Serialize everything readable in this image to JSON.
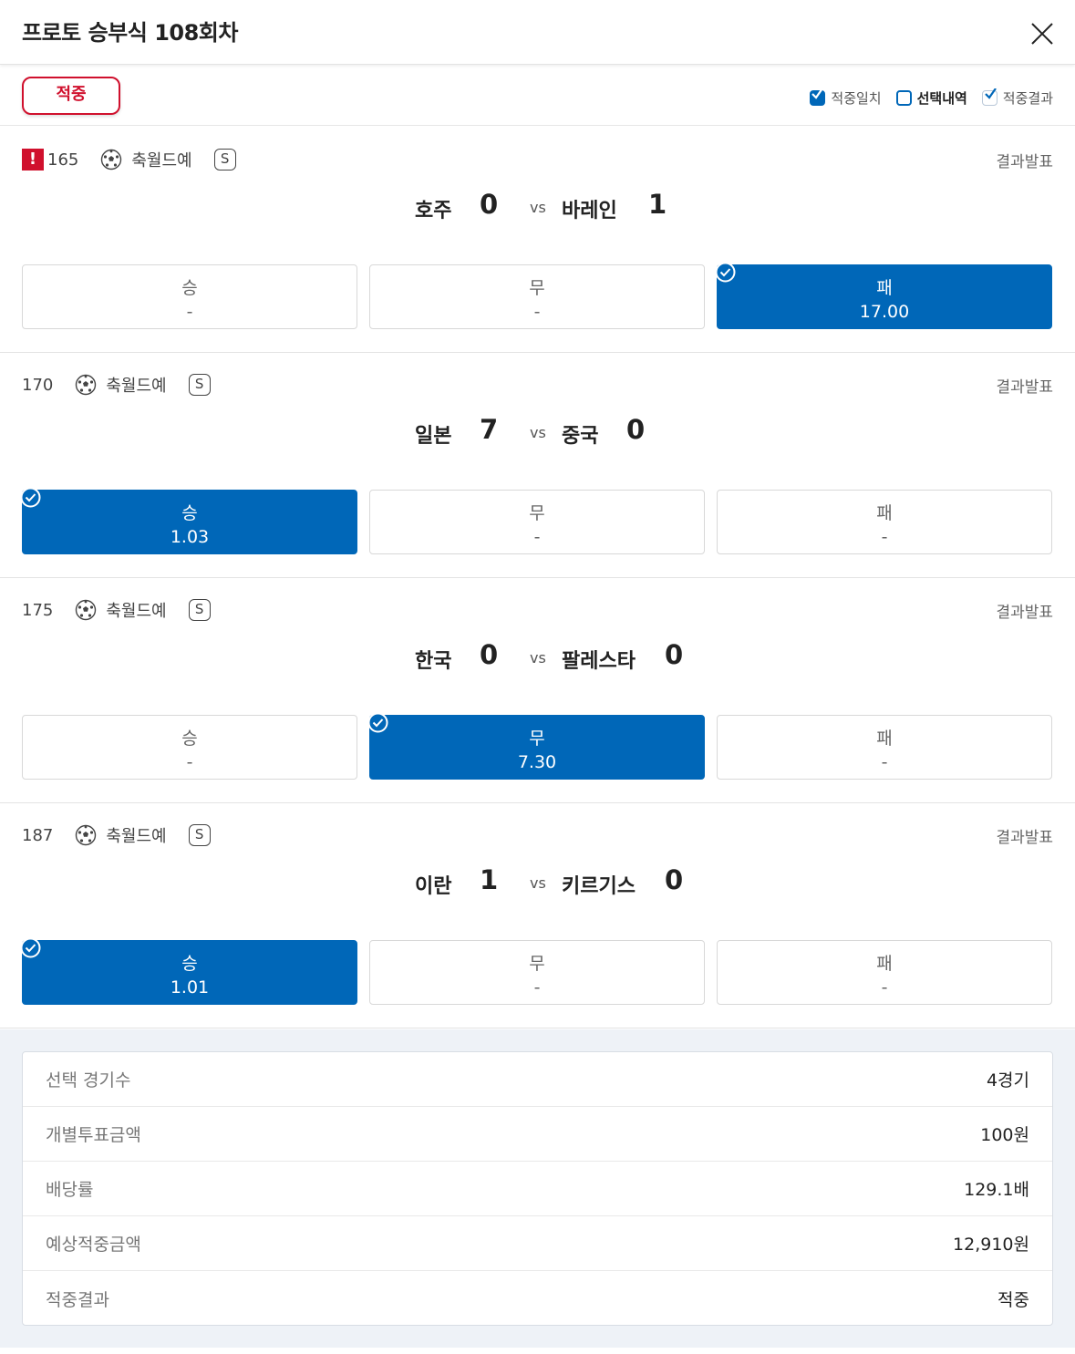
{
  "header": {
    "title": "프로토 승부식 108회차"
  },
  "filter": {
    "result_button": "적중",
    "legend": [
      {
        "label": "적중일치"
      },
      {
        "label": "선택내역"
      },
      {
        "label": "적중결과"
      }
    ]
  },
  "matches": [
    {
      "number": "165",
      "league": "축월드예",
      "badge": "S",
      "status": "결과발표",
      "home": "호주",
      "home_score": "0",
      "vs": "vs",
      "away": "바레인",
      "away_score": "1",
      "options": [
        {
          "label": "승",
          "value": "-"
        },
        {
          "label": "무",
          "value": "-"
        },
        {
          "label": "패",
          "value": "17.00"
        }
      ],
      "selected": 2
    },
    {
      "number": "170",
      "league": "축월드예",
      "badge": "S",
      "status": "결과발표",
      "home": "일본",
      "home_score": "7",
      "vs": "vs",
      "away": "중국",
      "away_score": "0",
      "options": [
        {
          "label": "승",
          "value": "1.03"
        },
        {
          "label": "무",
          "value": "-"
        },
        {
          "label": "패",
          "value": "-"
        }
      ],
      "selected": 0
    },
    {
      "number": "175",
      "league": "축월드예",
      "badge": "S",
      "status": "결과발표",
      "home": "한국",
      "home_score": "0",
      "vs": "vs",
      "away": "팔레스타",
      "away_score": "0",
      "options": [
        {
          "label": "승",
          "value": "-"
        },
        {
          "label": "무",
          "value": "7.30"
        },
        {
          "label": "패",
          "value": "-"
        }
      ],
      "selected": 1
    },
    {
      "number": "187",
      "league": "축월드예",
      "badge": "S",
      "status": "결과발표",
      "home": "이란",
      "home_score": "1",
      "vs": "vs",
      "away": "키르기스",
      "away_score": "0",
      "options": [
        {
          "label": "승",
          "value": "1.01"
        },
        {
          "label": "무",
          "value": "-"
        },
        {
          "label": "패",
          "value": "-"
        }
      ],
      "selected": 0
    }
  ],
  "summary": [
    {
      "key": "선택 경기수",
      "value": "4경기"
    },
    {
      "key": "개별투표금액",
      "value": "100원"
    },
    {
      "key": "배당률",
      "value": "129.1배"
    },
    {
      "key": "예상적중금액",
      "value": "12,910원"
    },
    {
      "key": "적중결과",
      "value": "적중"
    }
  ],
  "colors": {
    "accent": "#0067b8",
    "alert": "#d0102d"
  },
  "icons": {
    "close": "close-icon",
    "sport": "soccer-ball-icon",
    "check": "check-circle-icon"
  }
}
